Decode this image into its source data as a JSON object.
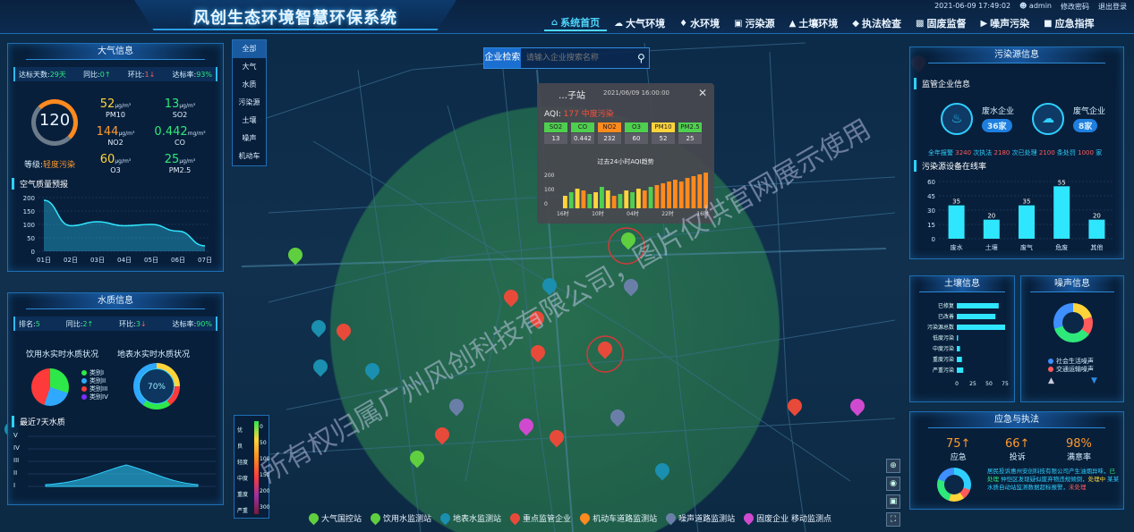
{
  "header": {
    "title": "风创生态环境智慧环保系统",
    "datetime": "2021-06-09 17:49:02",
    "user": "admin",
    "change_password": "修改密码",
    "logout": "退出登录",
    "nav": [
      {
        "label": "系统首页",
        "icon": "home-icon"
      },
      {
        "label": "大气环境",
        "icon": "cloud-icon"
      },
      {
        "label": "水环境",
        "icon": "water-drop-icon"
      },
      {
        "label": "污染源",
        "icon": "factory-icon"
      },
      {
        "label": "土壤环境",
        "icon": "soil-icon"
      },
      {
        "label": "执法检查",
        "icon": "car-icon"
      },
      {
        "label": "固废监督",
        "icon": "waste-icon"
      },
      {
        "label": "噪声污染",
        "icon": "speaker-icon"
      },
      {
        "label": "应急指挥",
        "icon": "alarm-icon"
      }
    ]
  },
  "air": {
    "title": "大气信息",
    "days_label": "达标天数:",
    "days": "29天",
    "yoy_label": "同比:",
    "yoy": "0",
    "mom_label": "环比:",
    "mom": "1",
    "rate_label": "达标率:",
    "rate": "93%",
    "aqi": "120",
    "level_label": "等级:",
    "level": "轻度污染",
    "pollutants": [
      {
        "value": "52",
        "unit": "μg/m³",
        "name": "PM10",
        "color": "#ffd43b"
      },
      {
        "value": "13",
        "unit": "μg/m³",
        "name": "SO2",
        "color": "#2ee87a"
      },
      {
        "value": "144",
        "unit": "μg/m³",
        "name": "NO2",
        "color": "#ff9a2e"
      },
      {
        "value": "0.442",
        "unit": "mg/m³",
        "name": "CO",
        "color": "#2ee87a"
      },
      {
        "value": "60",
        "unit": "μg/m³",
        "name": "O3",
        "color": "#ffd43b"
      },
      {
        "value": "25",
        "unit": "μg/m³",
        "name": "PM2.5",
        "color": "#2ee87a"
      }
    ],
    "forecast_title": "空气质量预报"
  },
  "air_forecast_chart": {
    "type": "area",
    "categories": [
      "01日",
      "02日",
      "03日",
      "04日",
      "05日",
      "06日",
      "07日"
    ],
    "values": [
      190,
      95,
      110,
      95,
      100,
      75,
      20
    ],
    "yticks": [
      "200",
      "150",
      "100",
      "50",
      "0"
    ],
    "ylim": [
      0,
      200
    ]
  },
  "water": {
    "title": "水质信息",
    "rank_label": "排名:",
    "rank": "5",
    "yoy_label": "同比:",
    "yoy": "2",
    "mom_label": "环比:",
    "mom": "3",
    "rate_label": "达标率:",
    "rate": "90%",
    "drink_title": "饮用水实时水质状况",
    "surface_title": "地表水实时水质状况",
    "legend": [
      {
        "label": "类别I",
        "color": "#2ee84a"
      },
      {
        "label": "类别II",
        "color": "#2fa8ff"
      },
      {
        "label": "类别III",
        "color": "#ff3a3a"
      },
      {
        "label": "类别IV",
        "color": "#7a2fff"
      }
    ],
    "donut_label": "70%",
    "week_title": "最近7天水质",
    "week_yticks": [
      "V",
      "IV",
      "III",
      "II",
      "I"
    ]
  },
  "layers": [
    "全部",
    "大气",
    "水质",
    "污染源",
    "土壤",
    "噪声",
    "机动车"
  ],
  "search": {
    "button": "企业检索",
    "placeholder": "请输入企业搜索名称"
  },
  "popup": {
    "station": "…子站",
    "time": "2021/06/09 16:00:00",
    "aqi_label": "AQI:",
    "aqi": "177 中度污染",
    "pollutants": [
      {
        "name": "SO2",
        "value": "13",
        "color": "#4fcf4f"
      },
      {
        "name": "CO",
        "value": "0.442",
        "color": "#4fcf4f"
      },
      {
        "name": "NO2",
        "value": "232",
        "color": "#ff8a1e"
      },
      {
        "name": "O3",
        "value": "60",
        "color": "#4fcf4f"
      },
      {
        "name": "PM10",
        "value": "52",
        "color": "#ffd43b"
      },
      {
        "name": "PM2.5",
        "value": "25",
        "color": "#4fcf4f"
      }
    ],
    "chart_title": "过去24小时AQI趋势",
    "chart_yticks": [
      "200",
      "100",
      "0"
    ],
    "chart_xticks": [
      "16时",
      "10时",
      "04时",
      "22时",
      "16时"
    ]
  },
  "aqi_bar_levels": [
    "优",
    "良",
    "轻度",
    "中度",
    "重度",
    "严重"
  ],
  "aqi_bar_ticks": [
    "0",
    "50",
    "100",
    "150",
    "200",
    "300"
  ],
  "pollution": {
    "title": "污染源信息",
    "sub_title": "监管企业信息",
    "waste_water_label": "废水企业",
    "waste_water_count": "36家",
    "waste_gas_label": "废气企业",
    "waste_gas_count": "8家",
    "summary": [
      {
        "text": "全年报警",
        "color": "#2fd0ff"
      },
      {
        "text": "3240",
        "color": "#ff5b5b"
      },
      {
        "text": "次执法",
        "color": "#2fd0ff"
      },
      {
        "text": "2180",
        "color": "#ff5b5b"
      },
      {
        "text": "次已处理",
        "color": "#2fd0ff"
      },
      {
        "text": "2100",
        "color": "#ff5b5b"
      },
      {
        "text": "条处罚",
        "color": "#2fd0ff"
      },
      {
        "text": "1000",
        "color": "#ff5b5b"
      },
      {
        "text": "家",
        "color": "#2fd0ff"
      }
    ],
    "online_title": "污染源设备在线率"
  },
  "online_chart": {
    "type": "bar",
    "categories": [
      "废水",
      "土壤",
      "废气",
      "危废",
      "其他"
    ],
    "values": [
      35,
      20,
      35,
      55,
      20
    ],
    "yticks": [
      "60",
      "45",
      "30",
      "15",
      "0"
    ],
    "ylim": [
      0,
      60
    ]
  },
  "soil": {
    "title": "土壤信息",
    "categories": [
      "已修复",
      "已改善",
      "污染源总数",
      "低度污染",
      "中度污染",
      "重度污染",
      "严重污染"
    ],
    "values": [
      65,
      60,
      75,
      2,
      5,
      8,
      10
    ],
    "xticks": [
      "0",
      "25",
      "50",
      "75"
    ]
  },
  "noise": {
    "title": "噪声信息",
    "legend": [
      {
        "label": "社会生活噪声",
        "color": "#3f8fff"
      },
      {
        "label": "交通运输噪声",
        "color": "#ff5b5b"
      }
    ]
  },
  "emergency": {
    "title": "应急与执法",
    "stats": [
      {
        "value": "75",
        "label": "应急",
        "color": "#ff9a2e"
      },
      {
        "value": "66",
        "label": "投诉",
        "color": "#ff9a2e"
      },
      {
        "value": "98%",
        "label": "满意率",
        "color": "#ff9a2e"
      }
    ],
    "notice_parts": [
      {
        "text": "居民投诉惠州安创科技有限公司产生油烟异味，",
        "color": "#2fd0ff"
      },
      {
        "text": "已处理",
        "color": "#2ee87a"
      },
      {
        "text": "仲恺区发现疑似废弃物违规倾倒，",
        "color": "#2fd0ff"
      },
      {
        "text": "处理中",
        "color": "#ffd43b"
      },
      {
        "text": "某某水质自动站监测数据超标报警，",
        "color": "#2fd0ff"
      },
      {
        "text": "未处理",
        "color": "#ff5b5b"
      }
    ]
  },
  "legend_bottom": [
    {
      "label": "大气国控站",
      "color": "#5fcf3f"
    },
    {
      "label": "饮用水监测站",
      "color": "#5fcf3f"
    },
    {
      "label": "地表水监测站",
      "color": "#1a8faf"
    },
    {
      "label": "重点监管企业",
      "color": "#e84a3a"
    },
    {
      "label": "机动车道路监测站",
      "color": "#ff8a1e"
    },
    {
      "label": "噪声道路监测站",
      "color": "#6a7fa8"
    },
    {
      "label": "固废企业 移动监测点",
      "color": "#d04ad0"
    }
  ],
  "watermark": "所有权归属广州风创科技有限公司，图片仅供官网展示使用"
}
